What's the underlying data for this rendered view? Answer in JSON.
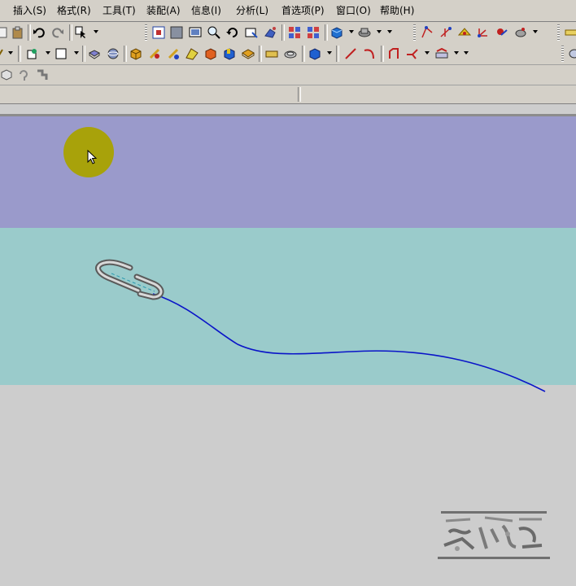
{
  "menubar": {
    "items": [
      {
        "label": "插入(S)"
      },
      {
        "label": "格式(R)"
      },
      {
        "label": "工具(T)"
      },
      {
        "label": "装配(A)"
      },
      {
        "label": "信息(I)"
      },
      {
        "label": "分析(L)"
      },
      {
        "label": "首选项(P)"
      },
      {
        "label": "窗口(O)"
      },
      {
        "label": "帮助(H)"
      }
    ]
  },
  "cue_line": {
    "prompt": "",
    "status": ""
  },
  "colors": {
    "chrome": "#d4d0c8",
    "viewport_band_top": "#9a9acb",
    "viewport_band_middle": "#9acbcb",
    "viewport_floor": "#cdcdcd",
    "path_curve": "#0a14c8",
    "cursor_highlight": "#a8a20a"
  },
  "viewport": {
    "model": "paperclip-shaped wire part",
    "path": "sweep guide curve"
  }
}
